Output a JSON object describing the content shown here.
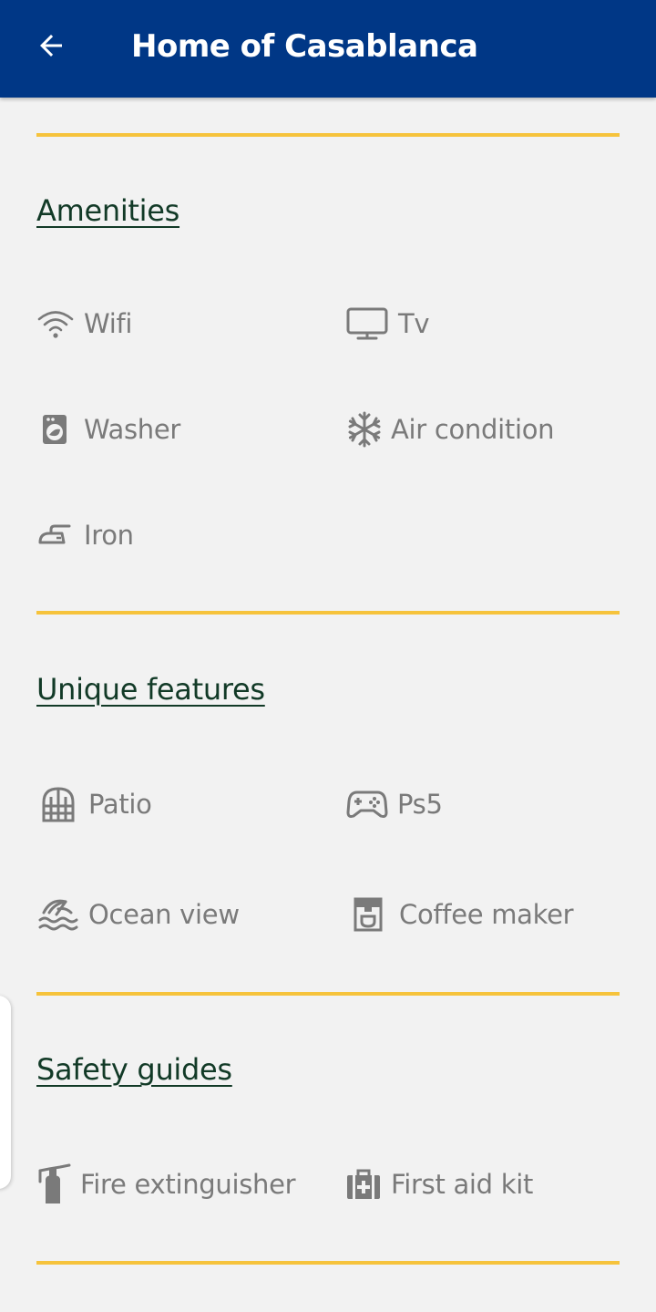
{
  "header": {
    "title": "Home of Casablanca",
    "back_icon": "arrow-back-icon",
    "background": "#003786"
  },
  "colors": {
    "accent": "#f6c33c",
    "section_title": "#123a27",
    "item_text": "#7a7a7a"
  },
  "sections": {
    "amenities": {
      "title": "Amenities",
      "items": [
        {
          "label": "Wifi",
          "icon": "wifi-icon"
        },
        {
          "label": "Tv",
          "icon": "tv-icon"
        },
        {
          "label": "Washer",
          "icon": "washer-icon"
        },
        {
          "label": "Air condition",
          "icon": "snowflake-icon"
        },
        {
          "label": "Iron",
          "icon": "iron-icon"
        }
      ]
    },
    "unique_features": {
      "title": "Unique features",
      "items": [
        {
          "label": "Patio",
          "icon": "patio-icon"
        },
        {
          "label": "Ps5",
          "icon": "gamepad-icon"
        },
        {
          "label": "Ocean view",
          "icon": "beach-icon"
        },
        {
          "label": "Coffee maker",
          "icon": "coffee-maker-icon"
        }
      ]
    },
    "safety_guides": {
      "title": "Safety guides",
      "items": [
        {
          "label": "Fire extinguisher",
          "icon": "fire-extinguisher-icon"
        },
        {
          "label": "First aid kit",
          "icon": "first-aid-kit-icon"
        }
      ]
    }
  }
}
